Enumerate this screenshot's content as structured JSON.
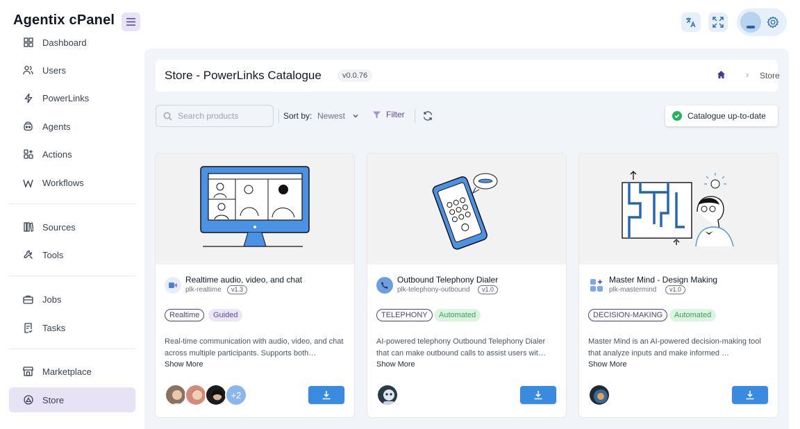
{
  "app": {
    "brand": "Agentix cPanel"
  },
  "topbar": {
    "menu_icon": "menu-icon",
    "translate_icon": "translate-icon",
    "fullscreen_icon": "fullscreen-icon",
    "settings_icon": "gear-icon"
  },
  "sidebar": {
    "items": [
      {
        "label": "Dashboard",
        "icon": "dashboard-icon"
      },
      {
        "label": "Users",
        "icon": "users-icon"
      },
      {
        "label": "PowerLinks",
        "icon": "bolt-icon"
      },
      {
        "label": "Agents",
        "icon": "agents-icon"
      },
      {
        "label": "Actions",
        "icon": "actions-icon"
      },
      {
        "label": "Workflows",
        "icon": "workflows-icon"
      },
      {
        "label": "Sources",
        "icon": "sources-icon"
      },
      {
        "label": "Tools",
        "icon": "tools-icon"
      },
      {
        "label": "Jobs",
        "icon": "jobs-icon"
      },
      {
        "label": "Tasks",
        "icon": "tasks-icon"
      },
      {
        "label": "Marketplace",
        "icon": "marketplace-icon"
      },
      {
        "label": "Store",
        "icon": "store-icon",
        "active": true
      }
    ]
  },
  "header": {
    "title": "Store - PowerLinks Catalogue",
    "version": "v0.0.76",
    "breadcrumb": {
      "current": "Store"
    }
  },
  "toolbar": {
    "search_placeholder": "Search products",
    "sort_label": "Sort by:",
    "sort_value": "Newest",
    "filter_label": "Filter",
    "status": "Catalogue up-to-date"
  },
  "cards": [
    {
      "title": "Realtime audio, video, and chat",
      "slug": "plk-realtime",
      "version": "v1.3",
      "tags": [
        "Realtime",
        "Guided"
      ],
      "description": "Real-time communication with audio, video, and chat across multiple participants. Supports both…",
      "show_more": "Show More",
      "extra_users": "+2",
      "icon": "video-call-icon"
    },
    {
      "title": "Outbound Telephony Dialer",
      "slug": "plk-telephony-outbound",
      "version": "v1.0",
      "tags": [
        "TELEPHONY",
        "Automated"
      ],
      "description": "AI-powered telephony Outbound Telephony Dialer that can make outbound calls to assist users wit…",
      "show_more": "Show More",
      "icon": "phone-icon"
    },
    {
      "title": "Master Mind - Design Making",
      "slug": "plk-mastermind",
      "version": "v1.0",
      "tags": [
        "DECISION-MAKING",
        "Automated"
      ],
      "description": "Master Mind is an AI-powered decision-making tool that analyze inputs and make informed …",
      "show_more": "Show More",
      "icon": "grid-sparkle-icon"
    }
  ],
  "colors": {
    "accent": "#3a8be0",
    "active_nav": "#e8e3f4",
    "success": "#22b45a",
    "main_bg": "#f1f4f9"
  }
}
